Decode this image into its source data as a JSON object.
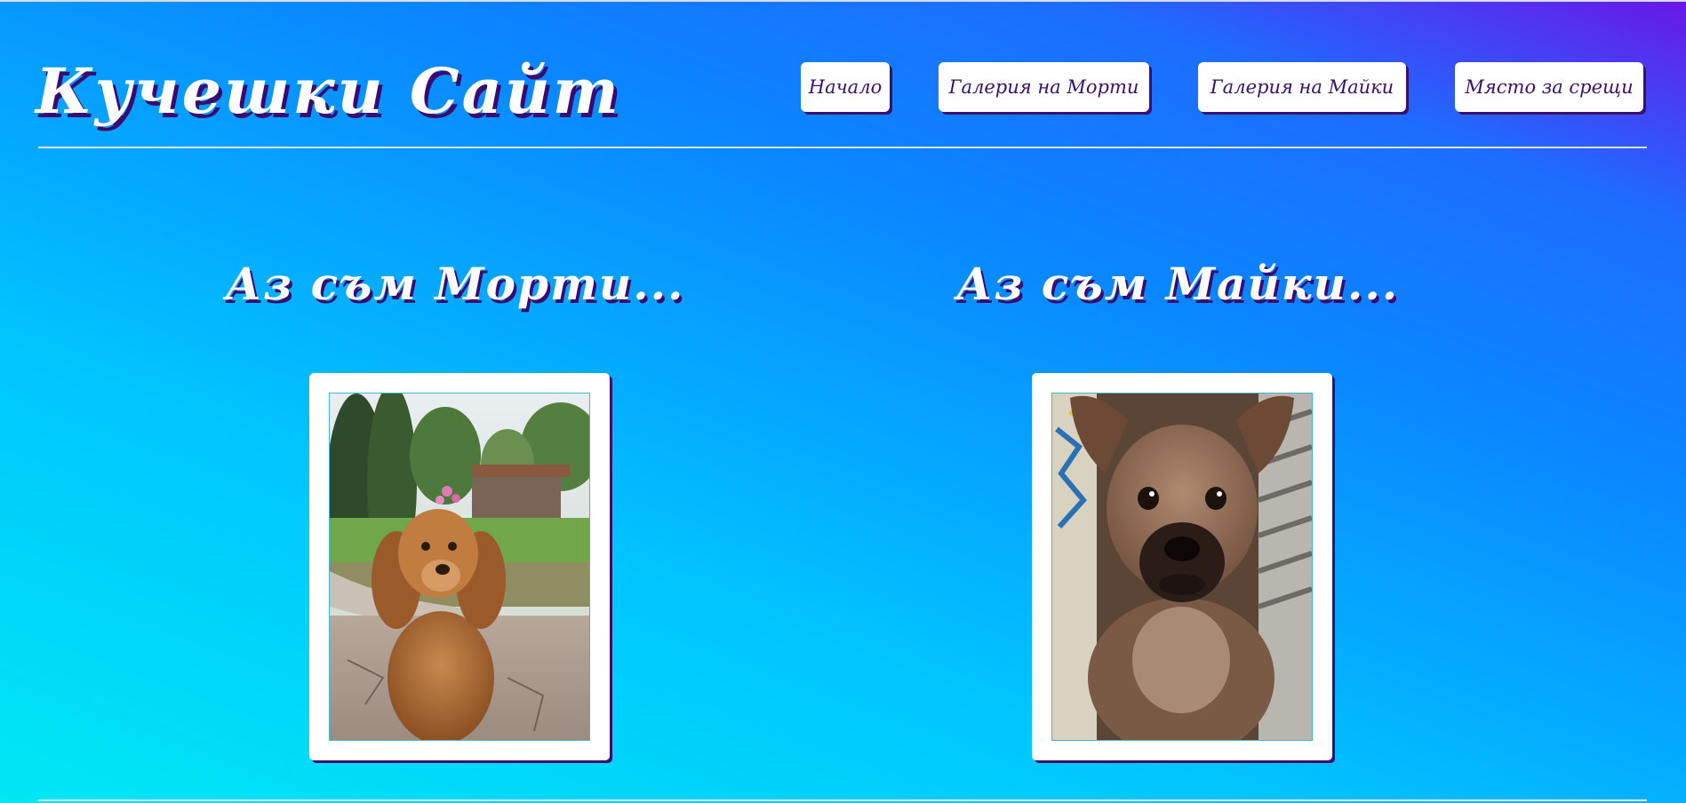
{
  "header": {
    "title": "Кучешки Сайт"
  },
  "nav": {
    "items": [
      {
        "label": "Начало"
      },
      {
        "label": "Галерия на Морти"
      },
      {
        "label": "Галерия на Майки"
      },
      {
        "label": "Място за срещи"
      }
    ]
  },
  "dogs": [
    {
      "heading": "Аз съм Морти...",
      "photo_alt": "Морти"
    },
    {
      "heading": "Аз съм Майки...",
      "photo_alt": "Майки"
    }
  ],
  "colors": {
    "gradient_start": "#00e8f4",
    "gradient_mid": "#0a86ff",
    "gradient_end": "#6a17e8",
    "text_shadow": "#3a0a6e",
    "nav_text": "#3b0f6e"
  }
}
